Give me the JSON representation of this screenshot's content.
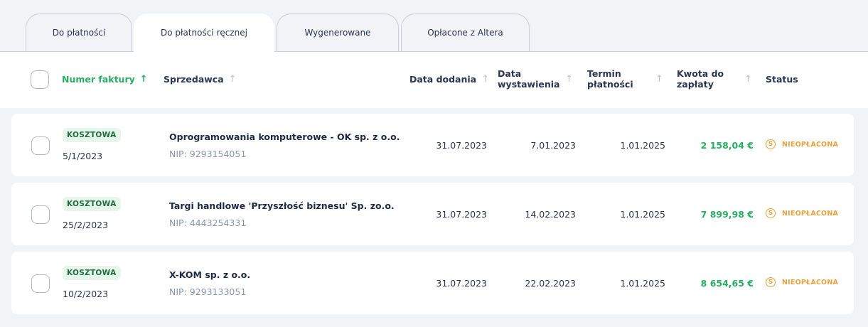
{
  "tabs": [
    "Do płatności",
    "Do płatności ręcznej",
    "Wygenerowane",
    "Opłacone z Altera"
  ],
  "active_tab": "Do płatności ręcznej",
  "columns": {
    "invoice_number": "Numer faktury",
    "seller": "Sprzedawca",
    "date_added": "Data dodania",
    "issue_date": "Data\nwystawienia",
    "due_date": "Termin\npłatności",
    "amount": "Kwota do\nzapłaty",
    "status": "Status"
  },
  "sort_arrow": "↑",
  "status_icon": "S",
  "colors": {
    "accent_green": "#27ae60",
    "status_orange": "#e9a13b",
    "badge_bg": "#e7f6ec"
  },
  "rows": [
    {
      "type": "KOSZTOWA",
      "invoice_number": "5/1/2023",
      "seller": "Oprogramowania komputerowe - OK sp. z o.o.",
      "nip": "NIP: 9293154051",
      "date_added": "31.07.2023",
      "issue_date": "7.01.2023",
      "due_date": "1.01.2025",
      "amount": "2 158,04 €",
      "status": "NIEOPŁACONA"
    },
    {
      "type": "KOSZTOWA",
      "invoice_number": "25/2/2023",
      "seller": "Targi handlowe 'Przyszłość biznesu' Sp. zo.o.",
      "nip": "NIP: 4443254331",
      "date_added": "31.07.2023",
      "issue_date": "14.02.2023",
      "due_date": "1.01.2025",
      "amount": "7 899,98 €",
      "status": "NIEOPŁACONA"
    },
    {
      "type": "KOSZTOWA",
      "invoice_number": "10/2/2023",
      "seller": "X-KOM sp. z o.o.",
      "nip": "NIP: 9293133051",
      "date_added": "31.07.2023",
      "issue_date": "22.02.2023",
      "due_date": "1.01.2025",
      "amount": "8 654,65 €",
      "status": "NIEOPŁACONA"
    }
  ]
}
